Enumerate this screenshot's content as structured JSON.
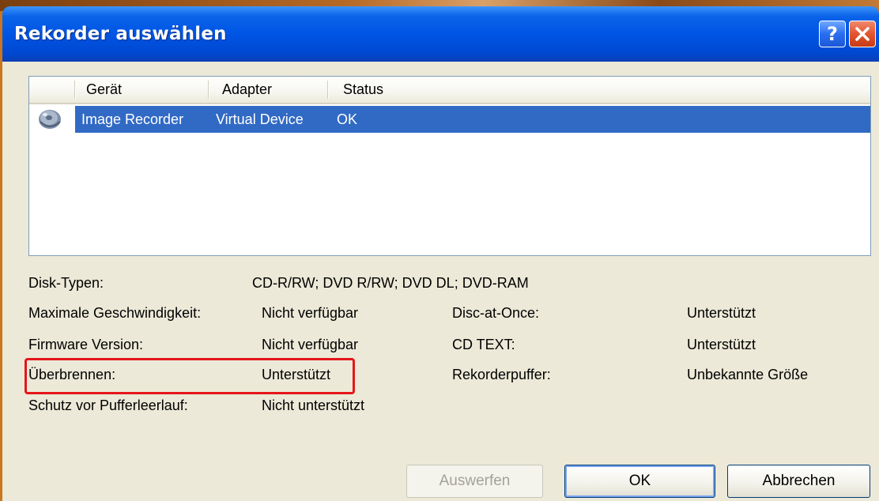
{
  "window": {
    "title": "Rekorder auswählen",
    "help_button": "?",
    "close_button": "×"
  },
  "device_list": {
    "columns": [
      "Gerät",
      "Adapter",
      "Status"
    ],
    "rows": [
      {
        "icon": "disc-drive-icon",
        "device": "Image Recorder",
        "adapter": "Virtual Device",
        "status": "OK",
        "selected": true
      }
    ]
  },
  "properties": {
    "disk_types_label": "Disk-Typen:",
    "disk_types_value": "CD-R/RW; DVD R/RW; DVD DL; DVD-RAM",
    "max_speed_label": "Maximale Geschwindigkeit:",
    "max_speed_value": "Nicht verfügbar",
    "firmware_label": "Firmware Version:",
    "firmware_value": "Nicht verfügbar",
    "overburn_label": "Überbrennen:",
    "overburn_value": "Unterstützt",
    "buffer_underrun_label": "Schutz vor Pufferleerlauf:",
    "buffer_underrun_value": "Nicht unterstützt",
    "dao_label": "Disc-at-Once:",
    "dao_value": "Unterstützt",
    "cdtext_label": "CD TEXT:",
    "cdtext_value": "Unterstützt",
    "recorder_buffer_label": "Rekorderpuffer:",
    "recorder_buffer_value": "Unbekannte Größe"
  },
  "buttons": {
    "eject": "Auswerfen",
    "ok": "OK",
    "cancel": "Abbrechen"
  },
  "colors": {
    "titlebar": "#0055e5",
    "selection": "#316ac5",
    "dialog_bg": "#ece9d8",
    "annotation": "#e5161a"
  }
}
